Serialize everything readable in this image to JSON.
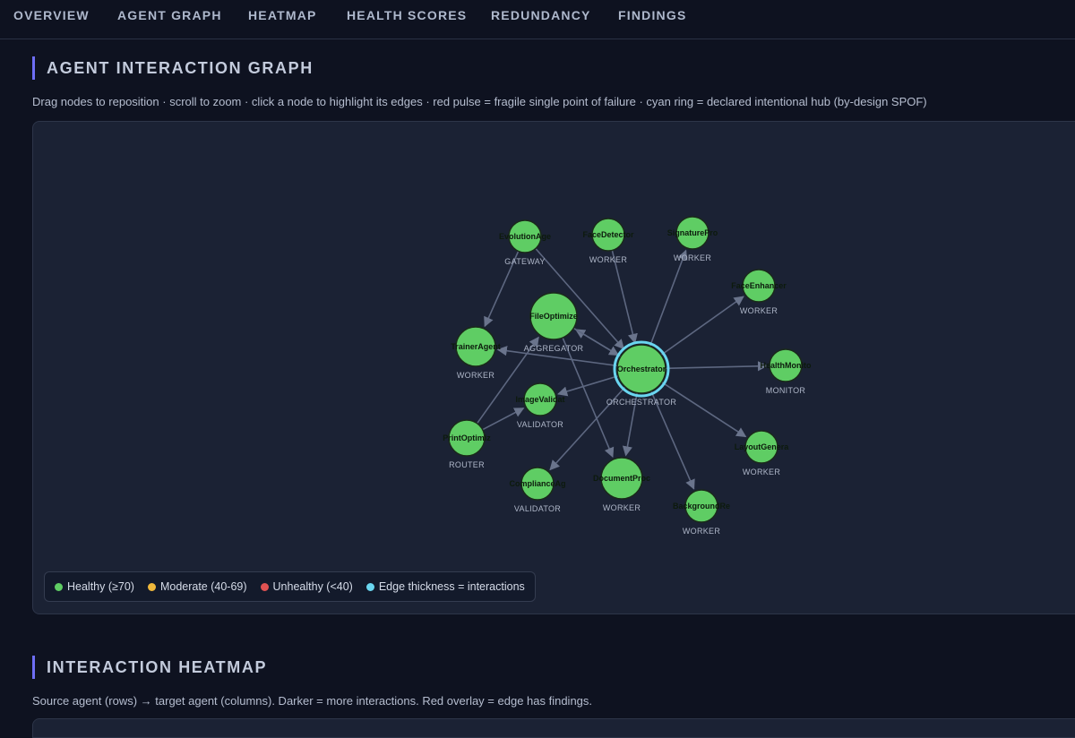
{
  "nav": {
    "tabs": [
      "OVERVIEW",
      "AGENT GRAPH",
      "HEATMAP",
      "HEALTH SCORES",
      "REDUNDANCY",
      "FINDINGS"
    ]
  },
  "graph_section": {
    "title": "AGENT INTERACTION GRAPH",
    "description": "Drag nodes to reposition · scroll to zoom · click a node to highlight its edges · red pulse = fragile single point of failure · cyan ring = declared intentional hub (by-design SPOF)"
  },
  "legend": {
    "healthy": "Healthy (≥70)",
    "moderate": "Moderate (40-69)",
    "unhealthy": "Unhealthy (<40)",
    "edge": "Edge thickness = interactions"
  },
  "colors": {
    "healthy": "#5fcd64",
    "moderate": "#f0b83b",
    "unhealthy": "#e05252",
    "hub_ring": "#6ad6f0",
    "edge": "#5d6780",
    "accent": "#6e6ef5"
  },
  "graph": {
    "nodes": [
      {
        "id": "orchestrator",
        "label": "Orchestrator",
        "type": "ORCHESTRATOR",
        "hub": true
      },
      {
        "id": "evolution",
        "label": "EvolutionAge",
        "type": "GATEWAY"
      },
      {
        "id": "facedetector",
        "label": "FaceDetector",
        "type": "WORKER"
      },
      {
        "id": "signature",
        "label": "SignaturePro",
        "type": "WORKER"
      },
      {
        "id": "faceenhancer",
        "label": "FaceEnhancer",
        "type": "WORKER"
      },
      {
        "id": "fileoptimizer",
        "label": "FileOptimize",
        "type": "AGGREGATOR"
      },
      {
        "id": "trainer",
        "label": "TrainerAgent",
        "type": "WORKER"
      },
      {
        "id": "healthmonitor",
        "label": "HealthMonito",
        "type": "MONITOR"
      },
      {
        "id": "imagevalidator",
        "label": "ImageValidat",
        "type": "VALIDATOR"
      },
      {
        "id": "printoptimizer",
        "label": "PrintOptimiz",
        "type": "ROUTER"
      },
      {
        "id": "layoutgen",
        "label": "LayoutGenera",
        "type": "WORKER"
      },
      {
        "id": "compliance",
        "label": "ComplianceAg",
        "type": "VALIDATOR"
      },
      {
        "id": "documentproc",
        "label": "DocumentProc",
        "type": "WORKER"
      },
      {
        "id": "background",
        "label": "BackgroundRe",
        "type": "WORKER"
      }
    ],
    "edges": [
      {
        "from": "orchestrator",
        "to": "signature"
      },
      {
        "from": "orchestrator",
        "to": "faceenhancer"
      },
      {
        "from": "orchestrator",
        "to": "healthmonitor"
      },
      {
        "from": "orchestrator",
        "to": "layoutgen"
      },
      {
        "from": "orchestrator",
        "to": "background"
      },
      {
        "from": "orchestrator",
        "to": "documentproc"
      },
      {
        "from": "orchestrator",
        "to": "compliance"
      },
      {
        "from": "orchestrator",
        "to": "imagevalidator"
      },
      {
        "from": "orchestrator",
        "to": "trainer"
      },
      {
        "from": "orchestrator",
        "to": "fileoptimizer"
      },
      {
        "from": "fileoptimizer",
        "to": "orchestrator"
      },
      {
        "from": "facedetector",
        "to": "orchestrator"
      },
      {
        "from": "evolution",
        "to": "orchestrator"
      },
      {
        "from": "evolution",
        "to": "trainer"
      },
      {
        "from": "printoptimizer",
        "to": "fileoptimizer"
      },
      {
        "from": "printoptimizer",
        "to": "imagevalidator"
      },
      {
        "from": "fileoptimizer",
        "to": "documentproc"
      }
    ]
  },
  "heatmap_section": {
    "title": "INTERACTION HEATMAP",
    "description": "Source agent (rows) → target agent (columns). Darker = more interactions. Red overlay = edge has findings."
  }
}
